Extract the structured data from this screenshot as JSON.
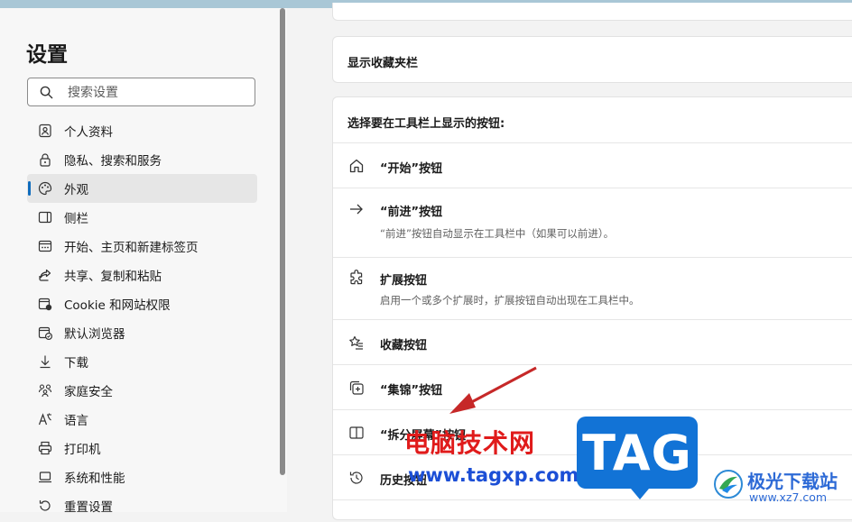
{
  "sidebar": {
    "title": "设置",
    "search_placeholder": "搜索设置",
    "items": [
      {
        "label": "个人资料",
        "icon": "profile-icon"
      },
      {
        "label": "隐私、搜索和服务",
        "icon": "lock-icon"
      },
      {
        "label": "外观",
        "icon": "palette-icon",
        "active": true
      },
      {
        "label": "侧栏",
        "icon": "sidebar-icon"
      },
      {
        "label": "开始、主页和新建标签页",
        "icon": "home-tab-icon"
      },
      {
        "label": "共享、复制和粘贴",
        "icon": "share-icon"
      },
      {
        "label": "Cookie 和网站权限",
        "icon": "cookie-icon"
      },
      {
        "label": "默认浏览器",
        "icon": "browser-icon"
      },
      {
        "label": "下载",
        "icon": "download-icon"
      },
      {
        "label": "家庭安全",
        "icon": "family-icon"
      },
      {
        "label": "语言",
        "icon": "language-icon"
      },
      {
        "label": "打印机",
        "icon": "printer-icon"
      },
      {
        "label": "系统和性能",
        "icon": "laptop-icon"
      },
      {
        "label": "重置设置",
        "icon": "reset-icon"
      }
    ]
  },
  "main": {
    "show_favorites_bar": "显示收藏夹栏",
    "toolbar_header": "选择要在工具栏上显示的按钮:",
    "rows": [
      {
        "label": "“开始”按钮",
        "desc": "",
        "icon": "home-icon"
      },
      {
        "label": "“前进”按钮",
        "desc": "“前进”按钮自动显示在工具栏中（如果可以前进）。",
        "icon": "forward-arrow-icon"
      },
      {
        "label": "扩展按钮",
        "desc": "启用一个或多个扩展时，扩展按钮自动出现在工具栏中。",
        "icon": "extensions-icon"
      },
      {
        "label": "收藏按钮",
        "desc": "",
        "icon": "favorites-icon"
      },
      {
        "label": "“集锦”按钮",
        "desc": "",
        "icon": "collections-icon"
      },
      {
        "label": "“拆分屏幕”按钮",
        "desc": "",
        "icon": "split-screen-icon"
      },
      {
        "label": "历史按钮",
        "desc": "",
        "icon": "history-icon"
      }
    ]
  },
  "watermark": {
    "site_name_cn": "电脑技术网",
    "site_url": "www.tagxp.com",
    "tag_logo": "TAG",
    "jg_title": "极光下载站",
    "jg_url": "www.xz7.com"
  },
  "colors": {
    "accent": "#0f6cbd",
    "watermark_red": "#e01b1b",
    "watermark_blue": "#1273d6"
  }
}
